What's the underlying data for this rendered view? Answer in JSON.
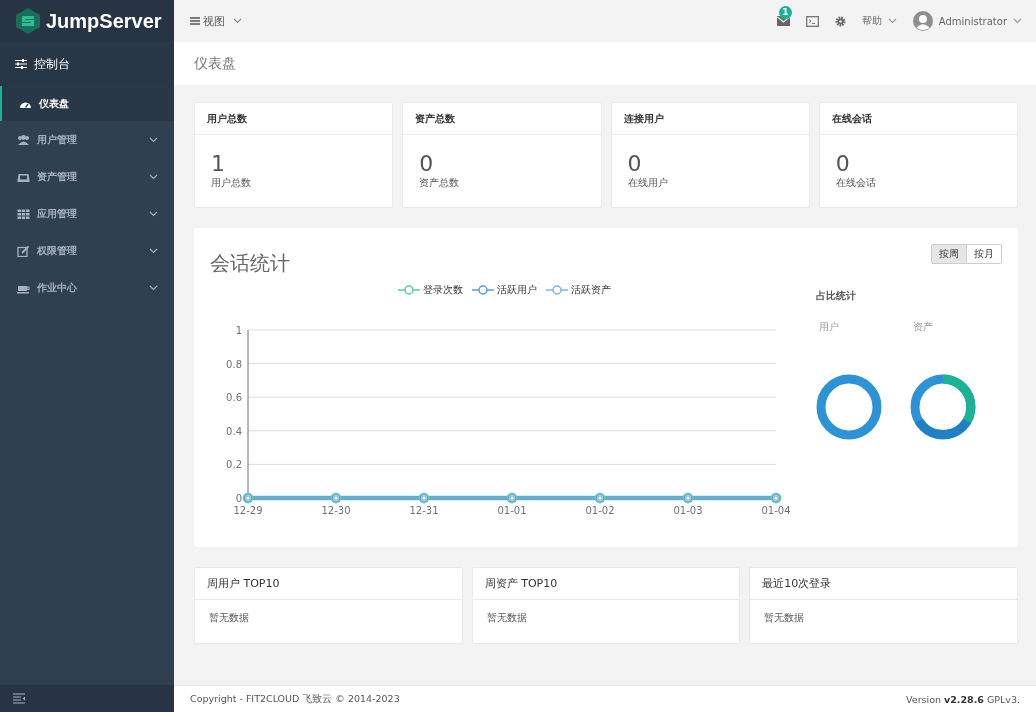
{
  "brand": {
    "name": "JumpServer"
  },
  "sidebar": {
    "section": "控制台",
    "items": [
      {
        "label": "仪表盘",
        "kind": "link",
        "selected": true
      },
      {
        "label": "用户管理",
        "kind": "group",
        "selected": false,
        "expanded": false
      },
      {
        "label": "资产管理",
        "kind": "group",
        "selected": false,
        "expanded": false
      },
      {
        "label": "应用管理",
        "kind": "group",
        "selected": false,
        "expanded": false
      },
      {
        "label": "权限管理",
        "kind": "group",
        "selected": false,
        "expanded": false
      },
      {
        "label": "作业中心",
        "kind": "group",
        "selected": false,
        "expanded": false
      }
    ]
  },
  "topbar": {
    "view_menu": "视图",
    "notification_count": "1",
    "help_menu": "帮助",
    "user": "Administrator"
  },
  "breadcrumb": "仪表盘",
  "stats": [
    {
      "title": "用户总数",
      "value": "1",
      "caption": "用户总数"
    },
    {
      "title": "资产总数",
      "value": "0",
      "caption": "资产总数"
    },
    {
      "title": "连接用户",
      "value": "0",
      "caption": "在线用户"
    },
    {
      "title": "在线会话",
      "value": "0",
      "caption": "在线会话"
    }
  ],
  "sessions": {
    "title": "会话统计",
    "toggle": [
      {
        "label": "按周",
        "selected": true
      },
      {
        "label": "按月",
        "selected": false
      }
    ],
    "chart_data": {
      "type": "line",
      "categories": [
        "12-29",
        "12-30",
        "12-31",
        "01-01",
        "01-02",
        "01-03",
        "01-04"
      ],
      "series": [
        {
          "name": "登录次数",
          "color": "#5fcaa3",
          "marker": "circle",
          "values": [
            0,
            0,
            0,
            0,
            0,
            0,
            0
          ]
        },
        {
          "name": "活跃用户",
          "color": "#5a9bd8",
          "marker": "circle",
          "values": [
            0,
            0,
            0,
            0,
            0,
            0,
            0
          ]
        },
        {
          "name": "活跃资产",
          "color": "#7ab8e6",
          "marker": "circle",
          "values": [
            0,
            0,
            0,
            0,
            0,
            0,
            0
          ]
        }
      ],
      "ylim": [
        0,
        1
      ],
      "yticks": [
        0,
        0.2,
        0.4,
        0.6,
        0.8,
        1
      ],
      "grid": true,
      "legend": true
    },
    "ratio": {
      "title": "占比统计",
      "labels": [
        "用户",
        "资产"
      ]
    }
  },
  "tops": [
    {
      "title": "周用户 TOP10",
      "empty": "暂无数据"
    },
    {
      "title": "周资产 TOP10",
      "empty": "暂无数据"
    },
    {
      "title": "最近10次登录",
      "empty": "暂无数据"
    }
  ],
  "footer": {
    "copyright": "Copyright - FIT2CLOUD 飞致云 © 2014-2023",
    "version": "Version **v2.28.6** GPLv3."
  }
}
